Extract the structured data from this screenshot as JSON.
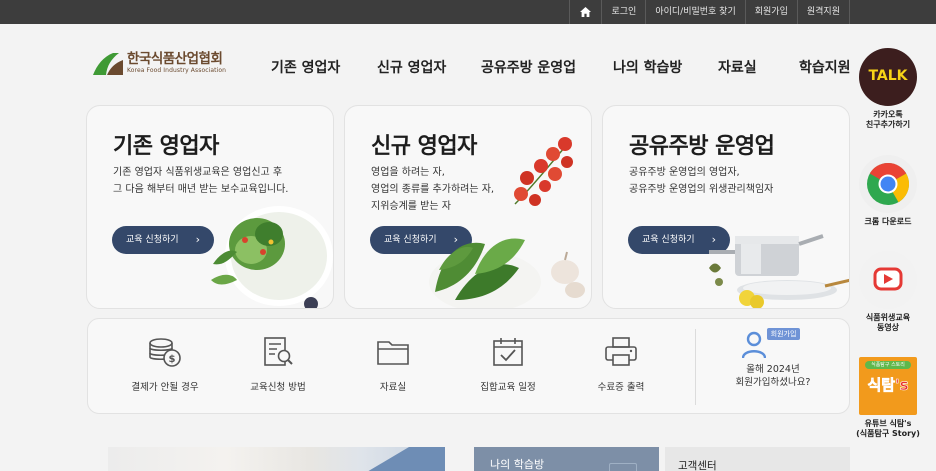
{
  "topbar": {
    "home_icon": "home-icon",
    "links": [
      "로그인",
      "아이디/비밀번호 찾기",
      "회원가입",
      "원격지원"
    ]
  },
  "logo": {
    "name_ko": "한국식품산업협회",
    "name_en": "Korea Food Industry Association",
    "colors": {
      "green": "#3f9a35",
      "brown": "#6b4a2f"
    }
  },
  "gnb": {
    "items": [
      "기존 영업자",
      "신규 영업자",
      "공유주방 운영업",
      "나의 학습방",
      "자료실",
      "학습지원"
    ]
  },
  "cards": [
    {
      "title": "기존 영업자",
      "desc": [
        "기존 영업자 식품위생교육은 영업신고 후",
        "그 다음 해부터 매년 받는 보수교육입니다."
      ],
      "button": "교육 신청하기"
    },
    {
      "title": "신규 영업자",
      "desc": [
        "영업을 하려는 자,",
        "영업의 종류를 추가하려는 자,",
        "지위승계를 받는 자"
      ],
      "button": "교육 신청하기"
    },
    {
      "title": "공유주방 운영업",
      "desc": [
        "공유주방 운영업의 영업자,",
        "공유주방 운영업의 위생관리책임자"
      ],
      "button": "교육 신청하기"
    }
  ],
  "quick_menu": {
    "items": [
      {
        "label": "결제가 안될 경우",
        "icon": "coins-dollar-icon"
      },
      {
        "label": "교육신청 방법",
        "icon": "document-search-icon"
      },
      {
        "label": "자료실",
        "icon": "folder-icon"
      },
      {
        "label": "집합교육 일정",
        "icon": "calendar-check-icon"
      },
      {
        "label": "수료증 출력",
        "icon": "printer-icon"
      }
    ],
    "member": {
      "badge": "회원가입",
      "question": [
        "올해 2024년",
        "회원가입하셨나요?"
      ],
      "icon": "person-icon"
    }
  },
  "bottom": {
    "study_label": "나의 학습방",
    "cs_label": "고객센터"
  },
  "side": {
    "items": [
      {
        "label": [
          "카카오톡",
          "친구추가하기"
        ],
        "icon": "kakao-talk-icon",
        "icon_text": "TALK"
      },
      {
        "label": [
          "크롬 다운로드"
        ],
        "icon": "chrome-icon"
      },
      {
        "label": [
          "식품위생교육",
          "동영상"
        ],
        "icon": "video-play-icon"
      },
      {
        "label": [
          "유튜브 식탐's",
          "(식품탐구 Story)"
        ],
        "icon": "sictam-icon",
        "icon_text": "식탐's",
        "icon_small": "식품탐구 스토리"
      }
    ]
  },
  "colors": {
    "topbar": "#3d3d3d",
    "button": "#34486a",
    "study": "#7d8fa7",
    "kakao": "#3c1e1e",
    "youtube_red": "#e53935"
  }
}
